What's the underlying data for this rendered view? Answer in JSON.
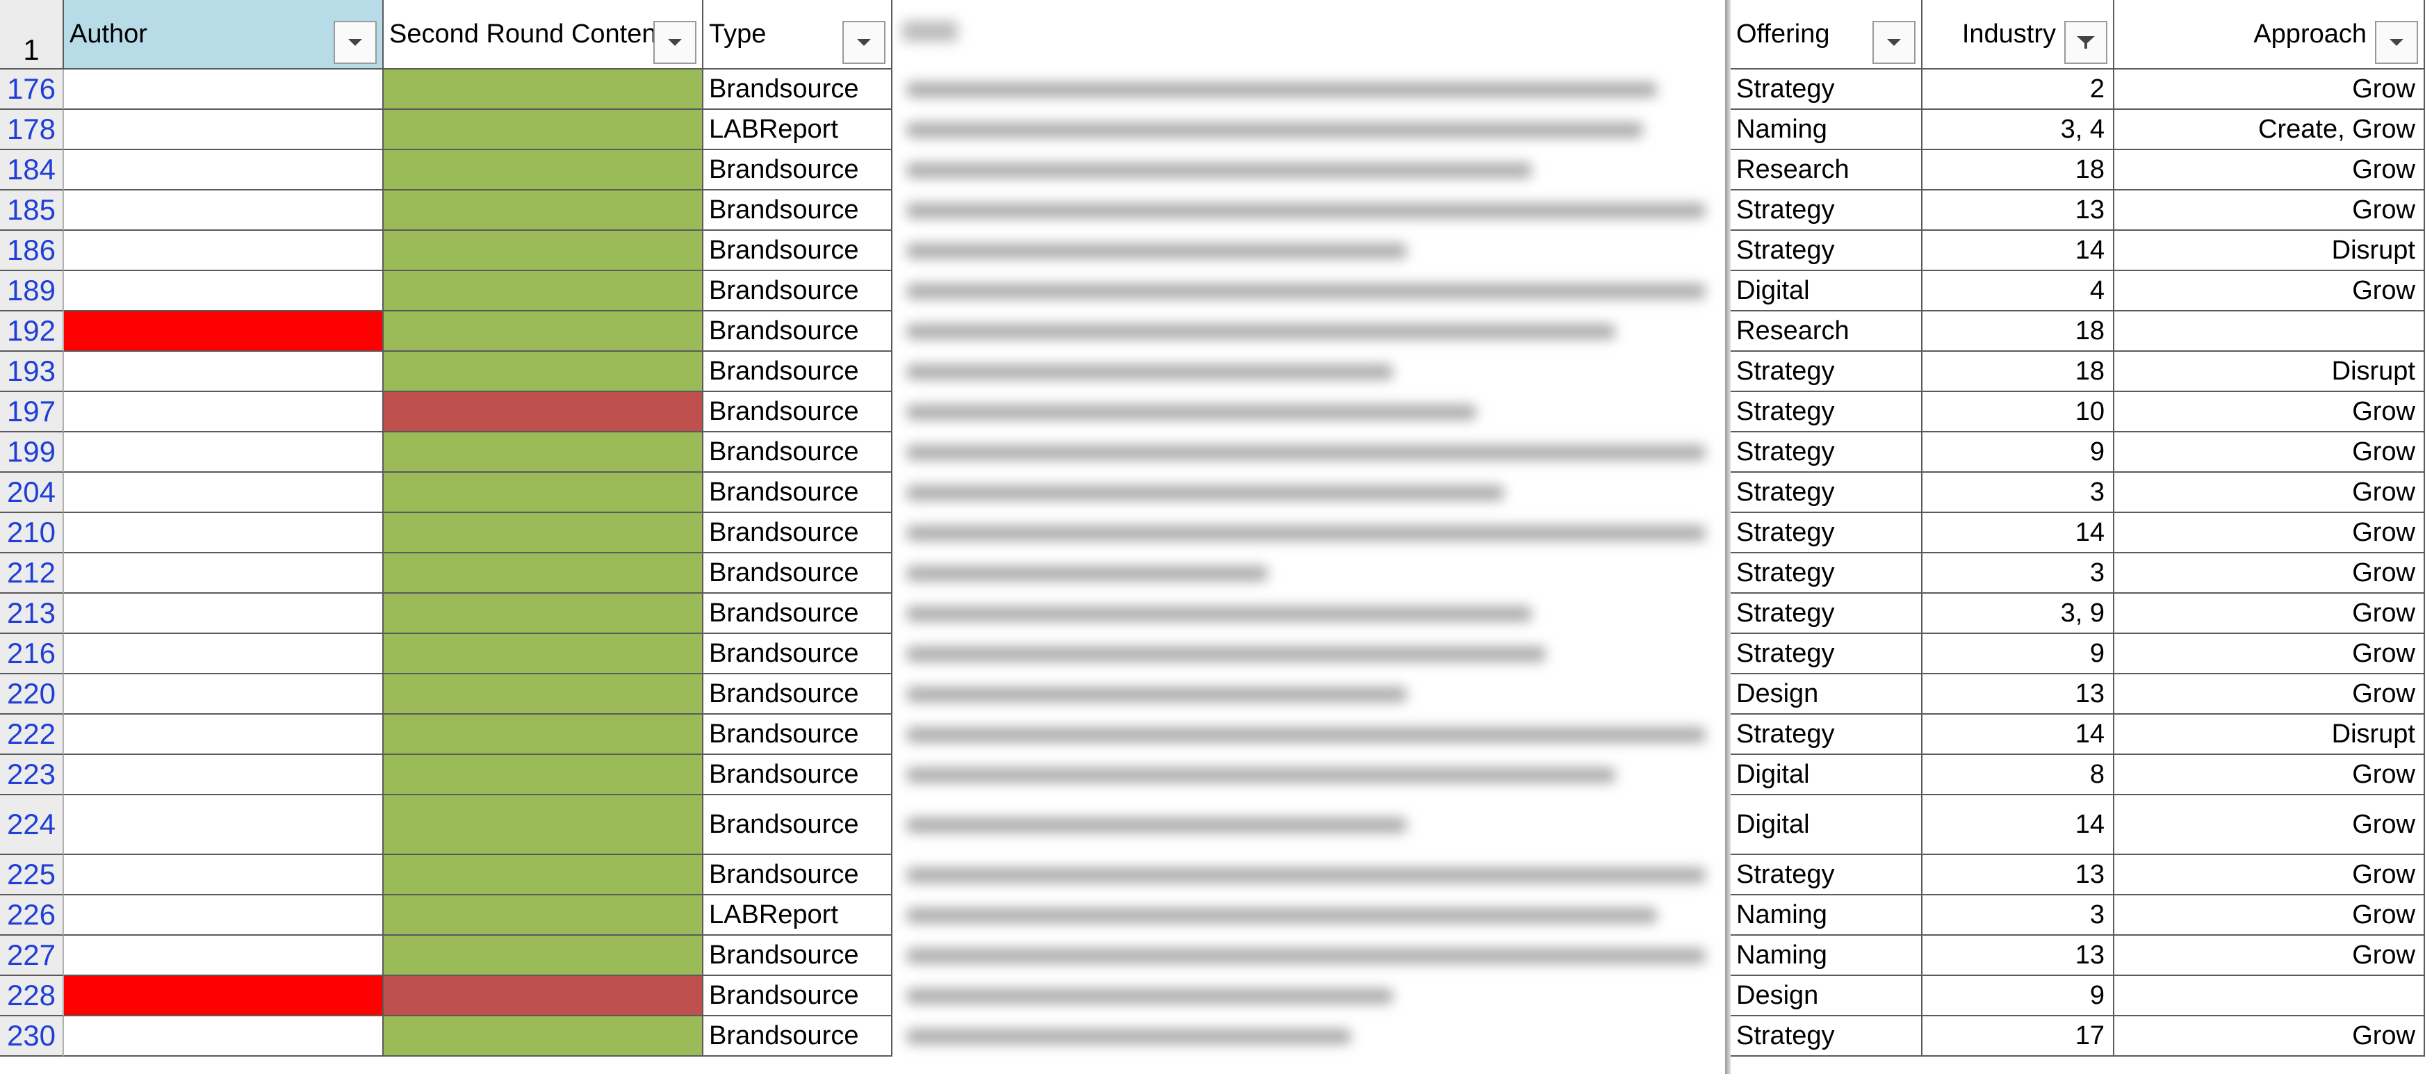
{
  "header_row_number": "1",
  "columns": {
    "author": "Author",
    "second_round": "Second Round Content",
    "type": "Type",
    "offering": "Offering",
    "industry": "Industry",
    "approach": "Approach"
  },
  "colors": {
    "header_fill": "#b8dbe8",
    "fill_red": "#ff0000",
    "fill_green": "#9bbb59",
    "fill_dark_red": "#c0504d",
    "row_number_text": "#1f3fd6"
  },
  "icons": {
    "dropdown": "dropdown-arrow-icon",
    "filtered": "filter-active-icon"
  },
  "rows": [
    {
      "num": "176",
      "author_fill": "none",
      "content_fill": "green",
      "type": "Brandsource",
      "offering": "Strategy",
      "industry": "2",
      "approach": "Grow"
    },
    {
      "num": "178",
      "author_fill": "none",
      "content_fill": "green",
      "type": "LABReport",
      "offering": "Naming",
      "industry": "3, 4",
      "approach": "Create, Grow"
    },
    {
      "num": "184",
      "author_fill": "none",
      "content_fill": "green",
      "type": "Brandsource",
      "offering": "Research",
      "industry": "18",
      "approach": "Grow"
    },
    {
      "num": "185",
      "author_fill": "none",
      "content_fill": "green",
      "type": "Brandsource",
      "offering": "Strategy",
      "industry": "13",
      "approach": "Grow"
    },
    {
      "num": "186",
      "author_fill": "none",
      "content_fill": "green",
      "type": "Brandsource",
      "offering": "Strategy",
      "industry": "14",
      "approach": "Disrupt"
    },
    {
      "num": "189",
      "author_fill": "none",
      "content_fill": "green",
      "type": "Brandsource",
      "offering": "Digital",
      "industry": "4",
      "approach": "Grow"
    },
    {
      "num": "192",
      "author_fill": "red",
      "content_fill": "green",
      "type": "Brandsource",
      "offering": "Research",
      "industry": "18",
      "approach": ""
    },
    {
      "num": "193",
      "author_fill": "none",
      "content_fill": "green",
      "type": "Brandsource",
      "offering": "Strategy",
      "industry": "18",
      "approach": "Disrupt"
    },
    {
      "num": "197",
      "author_fill": "none",
      "content_fill": "darkred",
      "type": "Brandsource",
      "offering": "Strategy",
      "industry": "10",
      "approach": "Grow"
    },
    {
      "num": "199",
      "author_fill": "none",
      "content_fill": "green",
      "type": "Brandsource",
      "offering": "Strategy",
      "industry": "9",
      "approach": "Grow"
    },
    {
      "num": "204",
      "author_fill": "none",
      "content_fill": "green",
      "type": "Brandsource",
      "offering": "Strategy",
      "industry": "3",
      "approach": "Grow"
    },
    {
      "num": "210",
      "author_fill": "none",
      "content_fill": "green",
      "type": "Brandsource",
      "offering": "Strategy",
      "industry": "14",
      "approach": "Grow"
    },
    {
      "num": "212",
      "author_fill": "none",
      "content_fill": "green",
      "type": "Brandsource",
      "offering": "Strategy",
      "industry": "3",
      "approach": "Grow"
    },
    {
      "num": "213",
      "author_fill": "none",
      "content_fill": "green",
      "type": "Brandsource",
      "offering": "Strategy",
      "industry": "3, 9",
      "approach": "Grow"
    },
    {
      "num": "216",
      "author_fill": "none",
      "content_fill": "green",
      "type": "Brandsource",
      "offering": "Strategy",
      "industry": "9",
      "approach": "Grow"
    },
    {
      "num": "220",
      "author_fill": "none",
      "content_fill": "green",
      "type": "Brandsource",
      "offering": "Design",
      "industry": "13",
      "approach": "Grow"
    },
    {
      "num": "222",
      "author_fill": "none",
      "content_fill": "green",
      "type": "Brandsource",
      "offering": "Strategy",
      "industry": "14",
      "approach": "Disrupt"
    },
    {
      "num": "223",
      "author_fill": "none",
      "content_fill": "green",
      "type": "Brandsource",
      "offering": "Digital",
      "industry": "8",
      "approach": "Grow"
    },
    {
      "num": "224",
      "author_fill": "none",
      "content_fill": "green",
      "type": "Brandsource",
      "offering": "Digital",
      "industry": "14",
      "approach": "Grow"
    },
    {
      "num": "225",
      "author_fill": "none",
      "content_fill": "green",
      "type": "Brandsource",
      "offering": "Strategy",
      "industry": "13",
      "approach": "Grow"
    },
    {
      "num": "226",
      "author_fill": "none",
      "content_fill": "green",
      "type": "LABReport",
      "offering": "Naming",
      "industry": "3",
      "approach": "Grow"
    },
    {
      "num": "227",
      "author_fill": "none",
      "content_fill": "green",
      "type": "Brandsource",
      "offering": "Naming",
      "industry": "13",
      "approach": "Grow"
    },
    {
      "num": "228",
      "author_fill": "red",
      "content_fill": "darkred",
      "type": "Brandsource",
      "offering": "Design",
      "industry": "9",
      "approach": ""
    },
    {
      "num": "230",
      "author_fill": "none",
      "content_fill": "green",
      "type": "Brandsource",
      "offering": "Strategy",
      "industry": "17",
      "approach": "Grow"
    }
  ]
}
